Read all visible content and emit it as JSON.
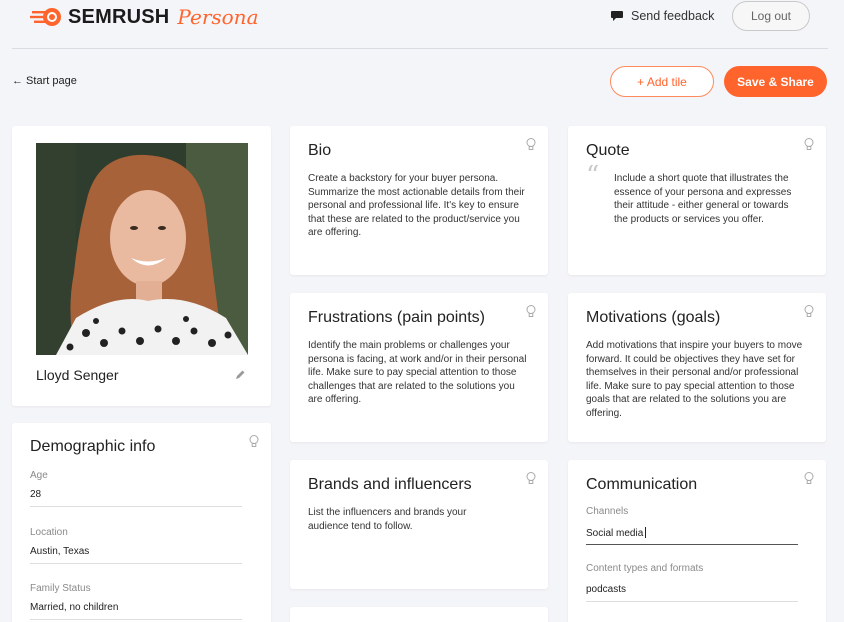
{
  "header": {
    "brand": "SEMRUSH",
    "product": "Persona",
    "feedback_label": "Send feedback",
    "logout_label": "Log out"
  },
  "toolbar": {
    "back_label": "← Start page",
    "add_tile_label": "+ Add tile",
    "save_label": "Save & Share"
  },
  "colors": {
    "accent": "#ff642d",
    "background": "#f4f5f9",
    "card": "#ffffff"
  },
  "profile": {
    "name": "Lloyd Senger"
  },
  "demographic": {
    "title": "Demographic info",
    "fields": [
      {
        "label": "Age",
        "value": "28"
      },
      {
        "label": "Location",
        "value": "Austin, Texas"
      },
      {
        "label": "Family Status",
        "value": "Married, no children"
      }
    ]
  },
  "cards": {
    "bio": {
      "title": "Bio",
      "body": "Create a backstory for your buyer persona. Summarize the most actionable details from their personal and professional life. It's key to ensure that these are related to the product/service you are offering."
    },
    "quote": {
      "title": "Quote",
      "body": "Include a short quote that illustrates the essence of your persona and expresses their attitude - either general or towards the products or services you offer."
    },
    "frustrations": {
      "title": "Frustrations (pain points)",
      "body": "Identify the main problems or challenges your persona is facing, at work and/or in their personal life. Make sure to pay special attention to those challenges that are related to the solutions you are offering."
    },
    "motivations": {
      "title": "Motivations (goals)",
      "body": "Add motivations that inspire your buyers to move forward. It could be objectives they have set for themselves in their personal and/or professional life. Make sure to pay special attention to those goals that are related to the solutions you are offering."
    },
    "brands": {
      "title": "Brands and influencers",
      "body": "List the influencers and brands your audience tend to follow."
    },
    "communication": {
      "title": "Communication",
      "channels_label": "Channels",
      "channels_value": "Social media",
      "content_label": "Content types and formats",
      "content_value": "podcasts"
    }
  },
  "icons": [
    "logo-icon",
    "feedback-icon",
    "lightbulb-icon",
    "pencil-icon",
    "quote-icon"
  ]
}
